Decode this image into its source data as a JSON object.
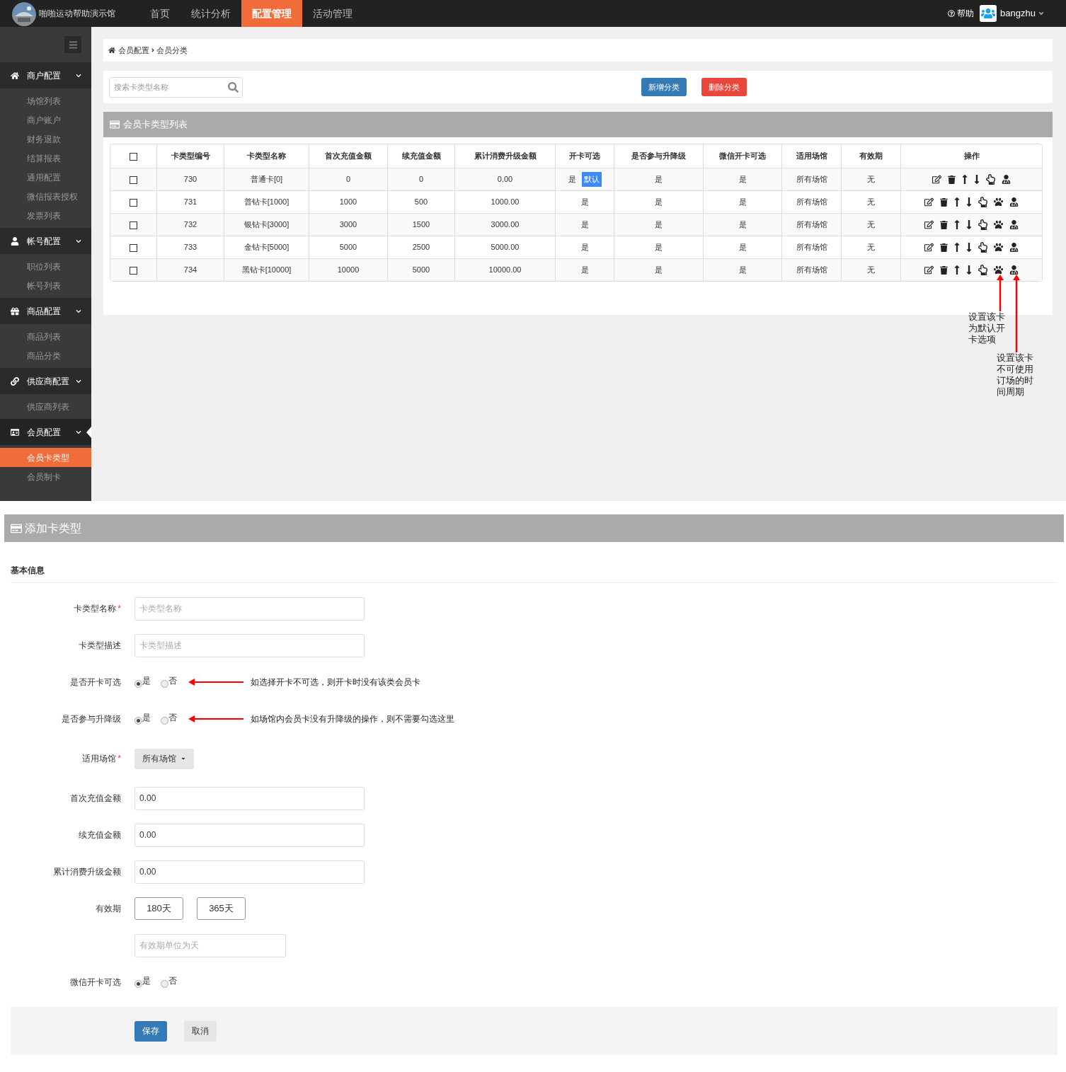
{
  "header": {
    "site_name": "啪啪运动帮助演示馆",
    "nav": [
      {
        "label": "首页",
        "selected": false
      },
      {
        "label": "统计分析",
        "selected": false
      },
      {
        "label": "配置管理",
        "selected": true
      },
      {
        "label": "活动管理",
        "selected": false
      }
    ],
    "help": "帮助",
    "user": "bangzhu"
  },
  "sidebar": {
    "groups": [
      {
        "label": "商户配置",
        "active": false,
        "items": [
          {
            "label": "场馆列表",
            "selected": false
          },
          {
            "label": "商户账户",
            "selected": false
          },
          {
            "label": "财务退款",
            "selected": false
          },
          {
            "label": "结算报表",
            "selected": false
          },
          {
            "label": "通用配置",
            "selected": false
          },
          {
            "label": "微信报表授权",
            "selected": false
          },
          {
            "label": "发票列表",
            "selected": false
          }
        ]
      },
      {
        "label": "帐号配置",
        "active": false,
        "items": [
          {
            "label": "职位列表",
            "selected": false
          },
          {
            "label": "帐号列表",
            "selected": false
          }
        ]
      },
      {
        "label": "商品配置",
        "active": false,
        "items": [
          {
            "label": "商品列表",
            "selected": false
          },
          {
            "label": "商品分类",
            "selected": false
          }
        ]
      },
      {
        "label": "供应商配置",
        "active": false,
        "items": [
          {
            "label": "供应商列表",
            "selected": false
          }
        ]
      },
      {
        "label": "会员配置",
        "active": true,
        "items": [
          {
            "label": "会员卡类型",
            "selected": true
          },
          {
            "label": "会员制卡",
            "selected": false
          }
        ]
      }
    ]
  },
  "breadcrumb": [
    "会员配置",
    "会员分类"
  ],
  "toolbar": {
    "search": {
      "placeholder": "搜索卡类型名称"
    },
    "buttons": [
      {
        "label": "新增分类",
        "kind": "primary"
      },
      {
        "label": "删除分类",
        "kind": "danger"
      }
    ]
  },
  "table": {
    "title": "会员卡类型列表",
    "all_checked": false,
    "default_label": "默认",
    "columns": [
      "卡类型编号",
      "卡类型名称",
      "首次充值金额",
      "续充值金额",
      "累计消费升级金额",
      "开卡可选",
      "是否参与升降级",
      "微信开卡可选",
      "适用场馆",
      "有效期",
      "操作"
    ],
    "rows": [
      {
        "checked": false,
        "default": true,
        "cells": [
          "730",
          "普通卡[0]",
          "0",
          "0",
          "0.00",
          "是",
          "是",
          "是",
          "所有场馆",
          "无"
        ]
      },
      {
        "checked": false,
        "default": false,
        "cells": [
          "731",
          "普钻卡[1000]",
          "1000",
          "500",
          "1000.00",
          "是",
          "是",
          "是",
          "所有场馆",
          "无"
        ]
      },
      {
        "checked": false,
        "default": false,
        "cells": [
          "732",
          "银钻卡[3000]",
          "3000",
          "1500",
          "3000.00",
          "是",
          "是",
          "是",
          "所有场馆",
          "无"
        ]
      },
      {
        "checked": false,
        "default": false,
        "cells": [
          "733",
          "金钻卡[5000]",
          "5000",
          "2500",
          "5000.00",
          "是",
          "是",
          "是",
          "所有场馆",
          "无"
        ]
      },
      {
        "checked": false,
        "default": false,
        "cells": [
          "734",
          "黑钻卡[10000]",
          "10000",
          "5000",
          "10000.00",
          "是",
          "是",
          "是",
          "所有场馆",
          "无"
        ]
      }
    ]
  },
  "annotations": [
    "设置该卡为默认开卡选项",
    "设置该卡不可使用订场的时间周期"
  ],
  "form": {
    "title": "添加卡类型",
    "section": "基本信息",
    "fields": [
      {
        "kind": "text",
        "label": "卡类型名称",
        "mark": "*",
        "placeholder": "卡类型名称"
      },
      {
        "kind": "text",
        "label": "卡类型描述",
        "placeholder": "卡类型描述"
      },
      {
        "kind": "radio",
        "label": "是否开卡可选",
        "options": [
          {
            "label": "是",
            "selected": true
          },
          {
            "label": "否",
            "selected": false
          }
        ],
        "note": "如选择开卡不可选，则开卡时没有该类会员卡"
      },
      {
        "kind": "radio",
        "label": "是否参与升降级",
        "options": [
          {
            "label": "是",
            "selected": true
          },
          {
            "label": "否",
            "selected": false
          }
        ],
        "note": "如场馆内会员卡没有升降级的操作，则不需要勾选这里"
      },
      {
        "kind": "select",
        "label": "适用场馆",
        "mark": "*",
        "value": "所有场馆"
      },
      {
        "kind": "text",
        "label": "首次充值金额",
        "value": "0.00"
      },
      {
        "kind": "text",
        "label": "续充值金额",
        "value": "0.00"
      },
      {
        "kind": "text",
        "label": "累计消费升级金额",
        "value": "0.00"
      },
      {
        "kind": "choice",
        "label": "有效期",
        "options": [
          "180天",
          "365天"
        ]
      },
      {
        "kind": "short",
        "placeholder": "有效期单位为天"
      },
      {
        "kind": "radio",
        "label": "微信开卡可选",
        "options": [
          {
            "label": "是",
            "selected": true
          },
          {
            "label": "否",
            "selected": false
          }
        ]
      }
    ],
    "actions": [
      {
        "label": "保存",
        "kind": "primary"
      },
      {
        "label": "取消",
        "kind": "default"
      }
    ]
  }
}
